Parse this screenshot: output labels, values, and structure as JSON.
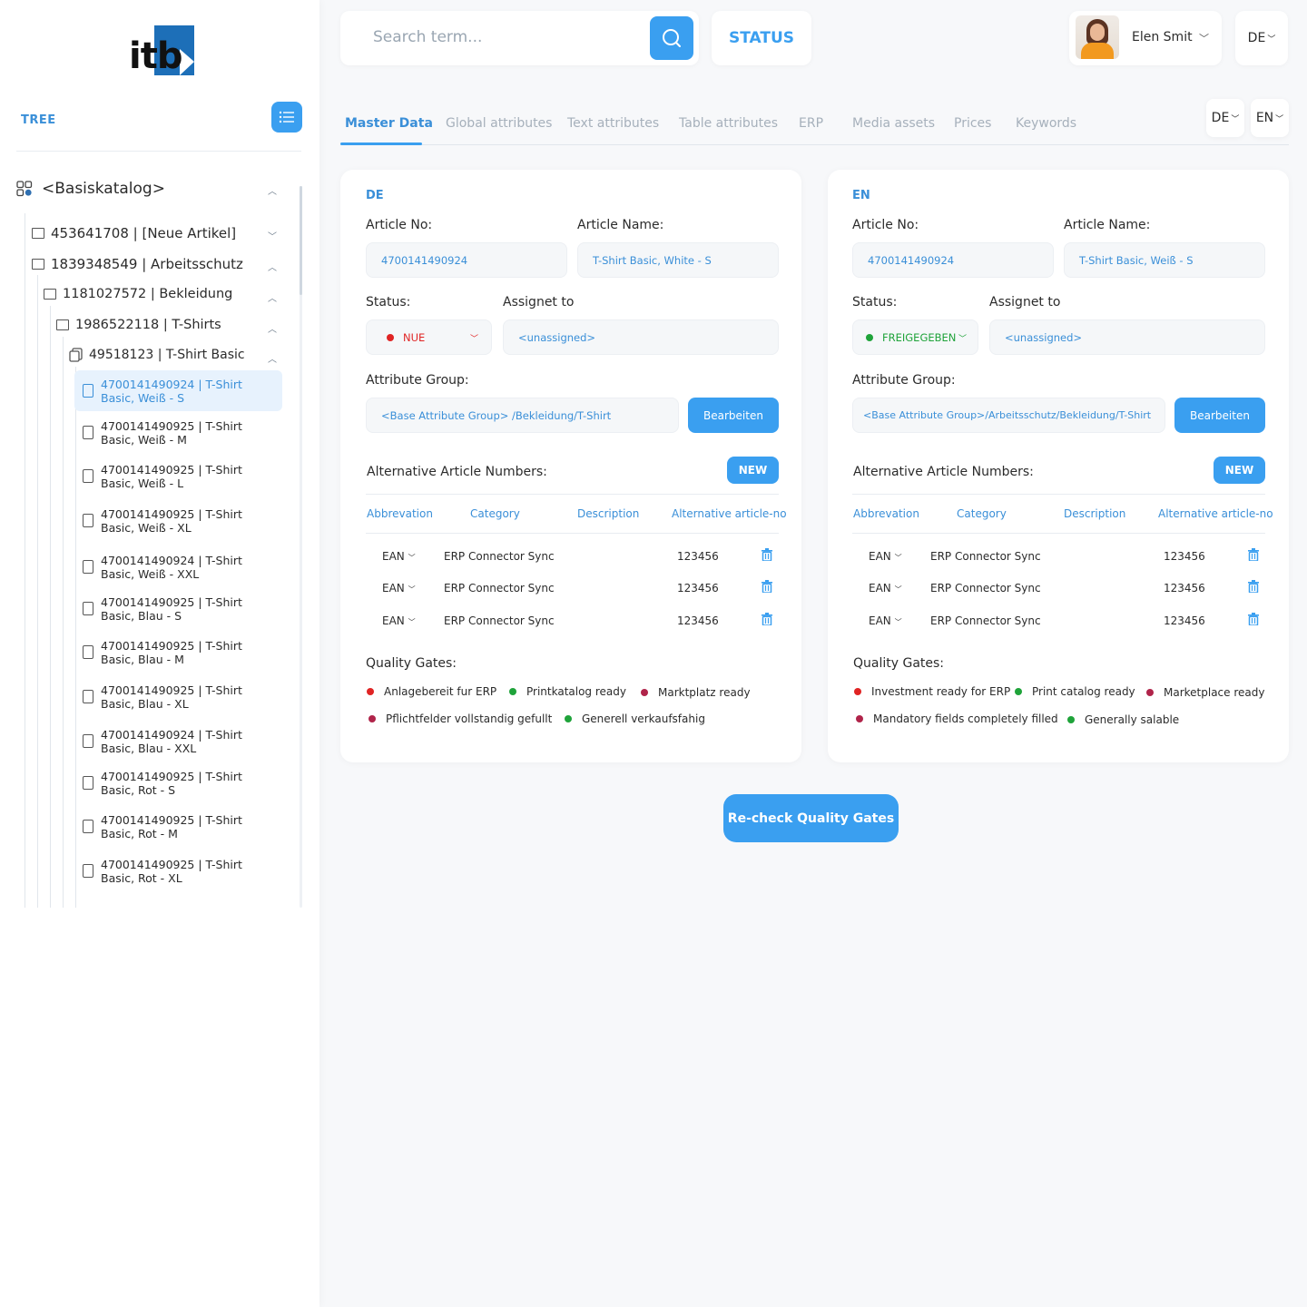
{
  "brand": {
    "logo_text": "itb",
    "accent": "#3a9ff0"
  },
  "sidebar": {
    "tree_label": "TREE",
    "root": {
      "label": "<Basiskatalog>"
    },
    "nodes": [
      {
        "label": "453641708 | [Neue Artikel]",
        "icon": "folder-icon"
      },
      {
        "label": "1839348549 | Arbeitsschutz",
        "icon": "folder-icon"
      },
      {
        "label": "1181027572 | Bekleidung",
        "icon": "folder-icon"
      },
      {
        "label": "1986522118 | T-Shirts",
        "icon": "folder-icon"
      },
      {
        "label": "49518123 | T-Shirt Basic",
        "icon": "product-group-icon"
      }
    ],
    "leaves": [
      {
        "line1": "4700141490924 | T-Shirt",
        "line2": "Basic, Weiß - S",
        "active": true
      },
      {
        "line1": "4700141490925 | T-Shirt",
        "line2": "Basic, Weiß - M"
      },
      {
        "line1": "4700141490925 | T-Shirt",
        "line2": "Basic, Weiß - L"
      },
      {
        "line1": "4700141490925 | T-Shirt",
        "line2": "Basic, Weiß - XL"
      },
      {
        "line1": "4700141490924 | T-Shirt",
        "line2": "Basic, Weiß - XXL"
      },
      {
        "line1": "4700141490925 | T-Shirt",
        "line2": "Basic, Blau - S"
      },
      {
        "line1": "4700141490925 | T-Shirt",
        "line2": "Basic, Blau - M"
      },
      {
        "line1": "4700141490925 | T-Shirt",
        "line2": "Basic, Blau - XL"
      },
      {
        "line1": "4700141490924 | T-Shirt",
        "line2": "Basic, Blau - XXL"
      },
      {
        "line1": "4700141490925 | T-Shirt",
        "line2": "Basic, Rot - S"
      },
      {
        "line1": "4700141490925 | T-Shirt",
        "line2": "Basic, Rot - M"
      },
      {
        "line1": "4700141490925 | T-Shirt",
        "line2": "Basic, Rot - XL"
      }
    ]
  },
  "header": {
    "search_placeholder": "Search term...",
    "status_label": "STATUS",
    "user_name": "Elen Smit",
    "language": "DE"
  },
  "tabs": [
    "Master Data",
    "Global attributes",
    "Text attributes",
    "Table attributes",
    "ERP",
    "Media assets",
    "Prices",
    "Keywords"
  ],
  "tab_languages": [
    "DE",
    "EN"
  ],
  "panels": [
    {
      "title": "DE",
      "article_no_label": "Article No:",
      "article_no": "4700141490924",
      "article_name_label": "Article Name:",
      "article_name": "T-Shirt Basic, White - S",
      "status_label": "Status:",
      "status": "NUE",
      "status_color": "#e02424",
      "assigned_label": "Assignet to",
      "assigned": "<unassigned>",
      "attr_group_label": "Attribute Group:",
      "attr_group": "<Base Attribute Group> /Bekleidung/T-Shirt",
      "edit_label": "Bearbeiten",
      "alt_label": "Alternative Article Numbers:",
      "new_label": "NEW",
      "columns": [
        "Abbrevation",
        "Category",
        "Description",
        "Alternative article-no"
      ],
      "rows": [
        {
          "abbr": "EAN",
          "category": "ERP Connector Sync",
          "altno": "123456"
        },
        {
          "abbr": "EAN",
          "category": "ERP Connector Sync",
          "altno": "123456"
        },
        {
          "abbr": "EAN",
          "category": "ERP Connector Sync",
          "altno": "123456"
        }
      ],
      "qg_label": "Quality Gates:",
      "gates": [
        {
          "label": "Anlagebereit fur ERP",
          "color": "#e02424"
        },
        {
          "label": "Printkatalog ready",
          "color": "#1fa33a"
        },
        {
          "label": "Marktplatz ready",
          "color": "#b0244a"
        },
        {
          "label": "Pflichtfelder vollstandig gefullt",
          "color": "#b0244a"
        },
        {
          "label": "Generell verkaufsfahig",
          "color": "#1fa33a"
        }
      ]
    },
    {
      "title": "EN",
      "article_no_label": "Article No:",
      "article_no": "4700141490924",
      "article_name_label": "Article Name:",
      "article_name": "T-Shirt Basic, Weiß - S",
      "status_label": "Status:",
      "status": "FREIGEGEBEN",
      "status_color": "#1fa33a",
      "assigned_label": "Assignet to",
      "assigned": "<unassigned>",
      "attr_group_label": "Attribute Group:",
      "attr_group": "<Base Attribute Group>/Arbeitsschutz/Bekleidung/T-Shirt",
      "edit_label": "Bearbeiten",
      "alt_label": "Alternative Article Numbers:",
      "new_label": "NEW",
      "columns": [
        "Abbrevation",
        "Category",
        "Description",
        "Alternative article-no"
      ],
      "rows": [
        {
          "abbr": "EAN",
          "category": "ERP Connector Sync",
          "altno": "123456"
        },
        {
          "abbr": "EAN",
          "category": "ERP Connector Sync",
          "altno": "123456"
        },
        {
          "abbr": "EAN",
          "category": "ERP Connector Sync",
          "altno": "123456"
        }
      ],
      "qg_label": "Quality Gates:",
      "gates": [
        {
          "label": "Investment ready for ERP",
          "color": "#e02424"
        },
        {
          "label": "Print catalog ready",
          "color": "#1fa33a"
        },
        {
          "label": "Marketplace ready",
          "color": "#b0244a"
        },
        {
          "label": "Mandatory fields completely filled",
          "color": "#b0244a"
        },
        {
          "label": "Generally salable",
          "color": "#1fa33a"
        }
      ]
    }
  ],
  "recheck_label": "Re-check Quality Gates"
}
